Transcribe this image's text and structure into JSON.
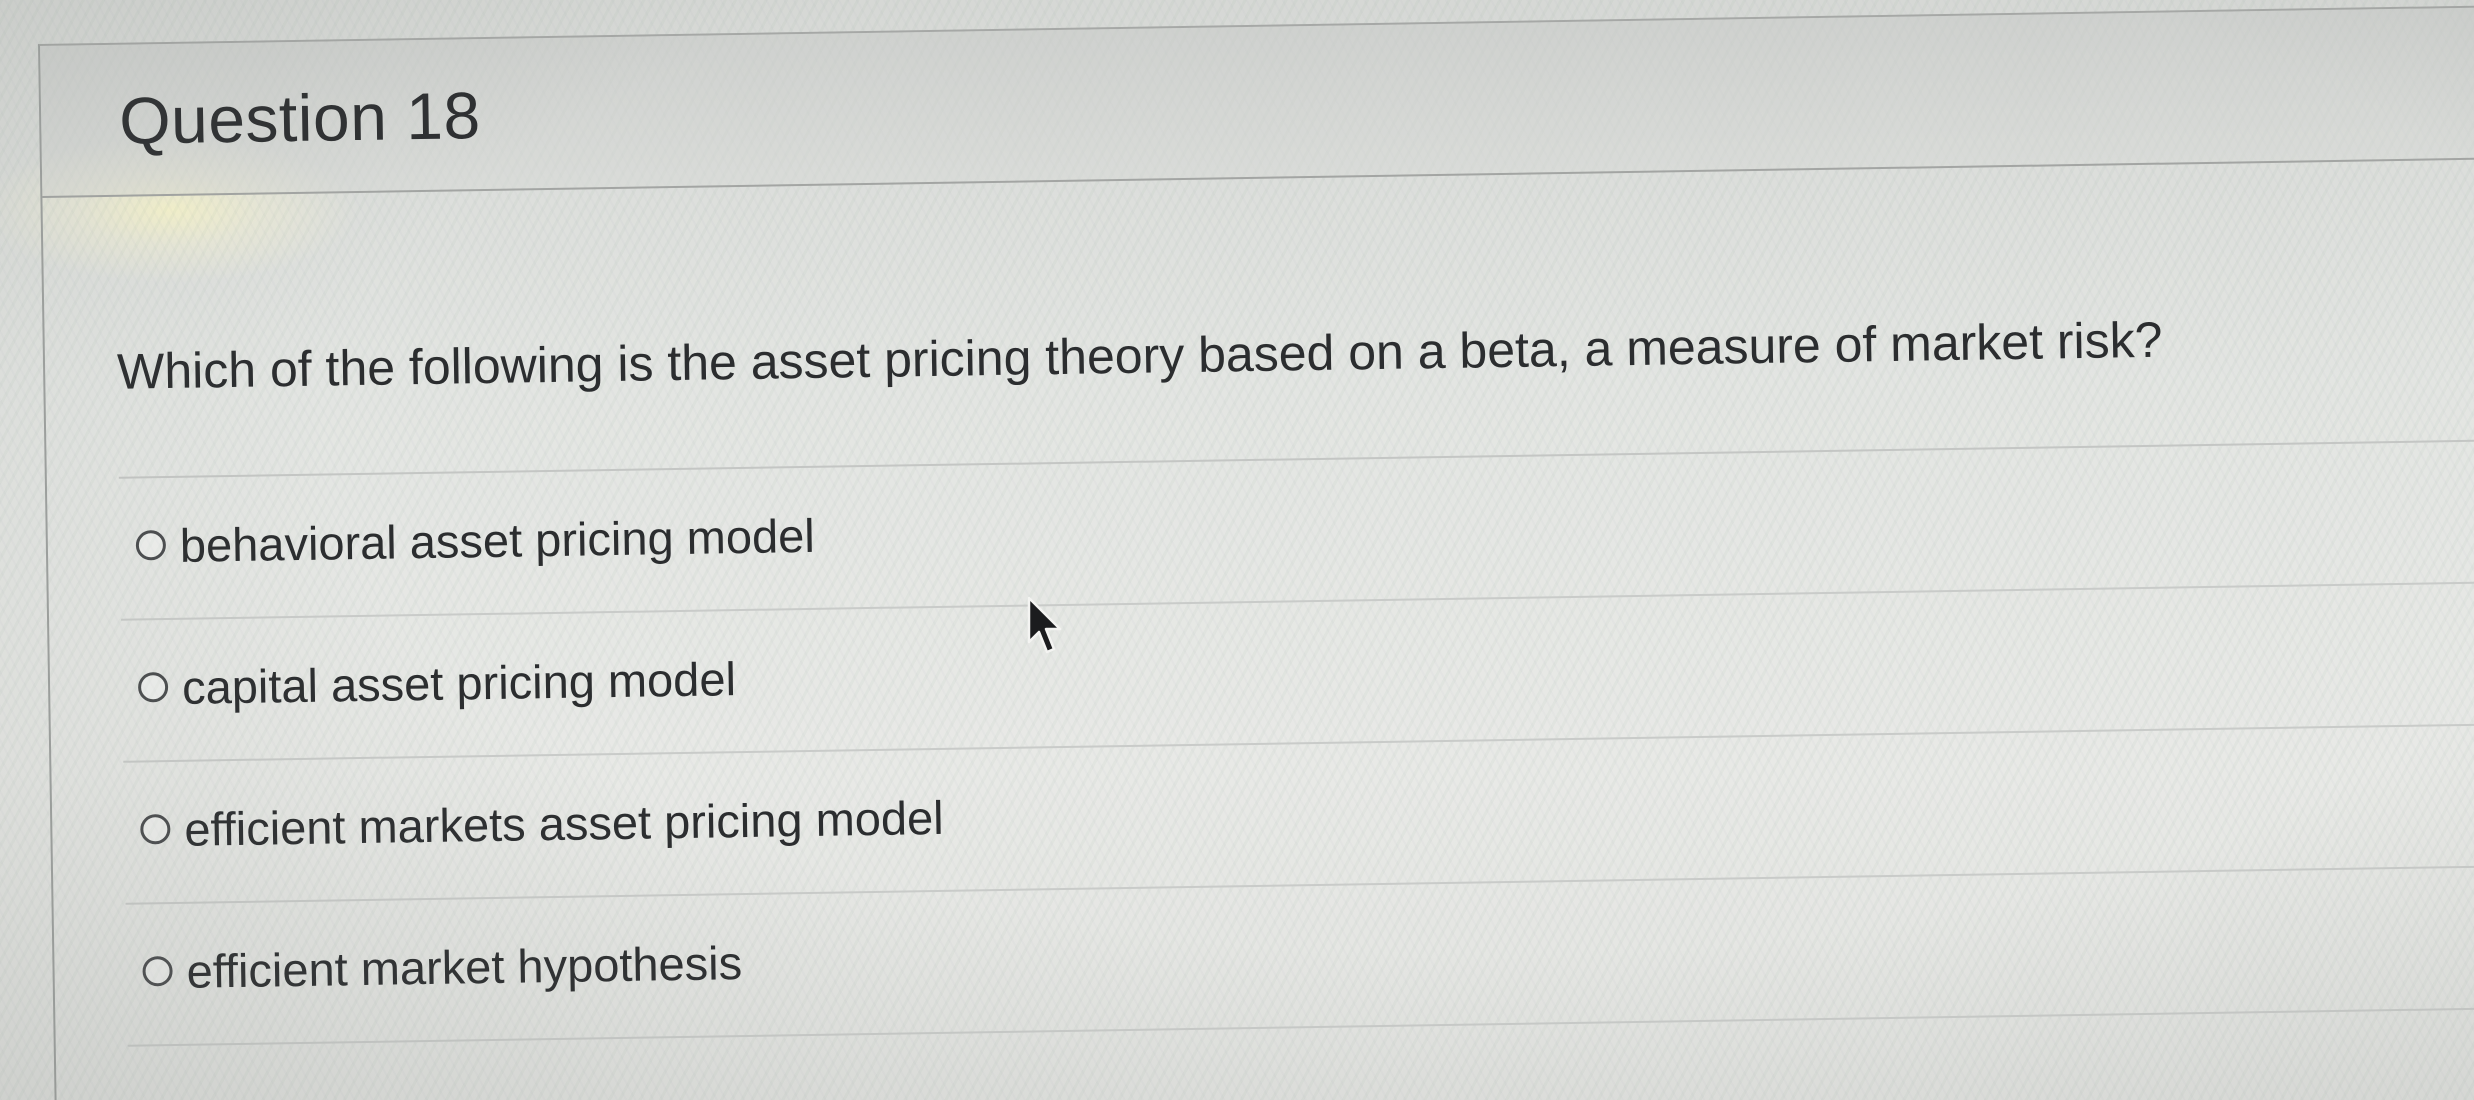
{
  "question": {
    "title": "Question 18",
    "text": "Which of the following is the asset pricing theory based on a beta, a measure of market risk?"
  },
  "answers": [
    {
      "label": "behavioral asset pricing model",
      "selected": false
    },
    {
      "label": "capital asset pricing model",
      "selected": false
    },
    {
      "label": "efficient markets asset pricing model",
      "selected": false
    },
    {
      "label": "efficient market hypothesis",
      "selected": false
    }
  ],
  "cursor": {
    "icon": "arrow-pointer-icon"
  },
  "colors": {
    "text": "#2b2d2f",
    "header_background": "#cfd1ce",
    "divider": "#c4c6c4",
    "page_background": "#e3e5e2"
  }
}
